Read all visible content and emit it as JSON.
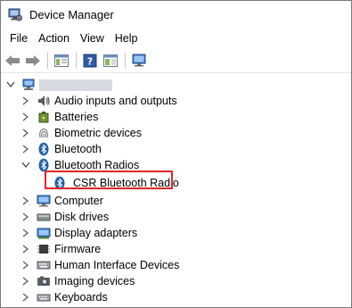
{
  "window": {
    "title": "Device Manager"
  },
  "menu": [
    "File",
    "Action",
    "View",
    "Help"
  ],
  "toolbar": {
    "buttons": [
      "back-icon",
      "forward-icon",
      "properties-icon",
      "help-icon",
      "show-hide-icon",
      "monitor-icon"
    ]
  },
  "tree": {
    "root": {
      "icon": "computer-icon",
      "expanded": true,
      "name_redacted": true
    },
    "items": [
      {
        "label": "Audio inputs and outputs",
        "icon": "speaker-icon",
        "expanded": false
      },
      {
        "label": "Batteries",
        "icon": "battery-icon",
        "expanded": false
      },
      {
        "label": "Biometric devices",
        "icon": "fingerprint-icon",
        "expanded": false
      },
      {
        "label": "Bluetooth",
        "icon": "bluetooth-icon",
        "expanded": false
      },
      {
        "label": "Bluetooth Radios",
        "icon": "bluetooth-icon",
        "expanded": true,
        "children": [
          {
            "label": "CSR Bluetooth Radio",
            "icon": "bluetooth-icon",
            "highlighted": true
          }
        ]
      },
      {
        "label": "Computer",
        "icon": "computer-icon",
        "expanded": false
      },
      {
        "label": "Disk drives",
        "icon": "disk-icon",
        "expanded": false
      },
      {
        "label": "Display adapters",
        "icon": "display-adapter-icon",
        "expanded": false
      },
      {
        "label": "Firmware",
        "icon": "chip-icon",
        "expanded": false
      },
      {
        "label": "Human Interface Devices",
        "icon": "hid-icon",
        "expanded": false
      },
      {
        "label": "Imaging devices",
        "icon": "camera-icon",
        "expanded": false
      },
      {
        "label": "Keyboards",
        "icon": "keyboard-icon",
        "expanded": false
      }
    ]
  },
  "colors": {
    "highlight_border": "#e0262b",
    "bluetooth": "#1f5fa8"
  }
}
